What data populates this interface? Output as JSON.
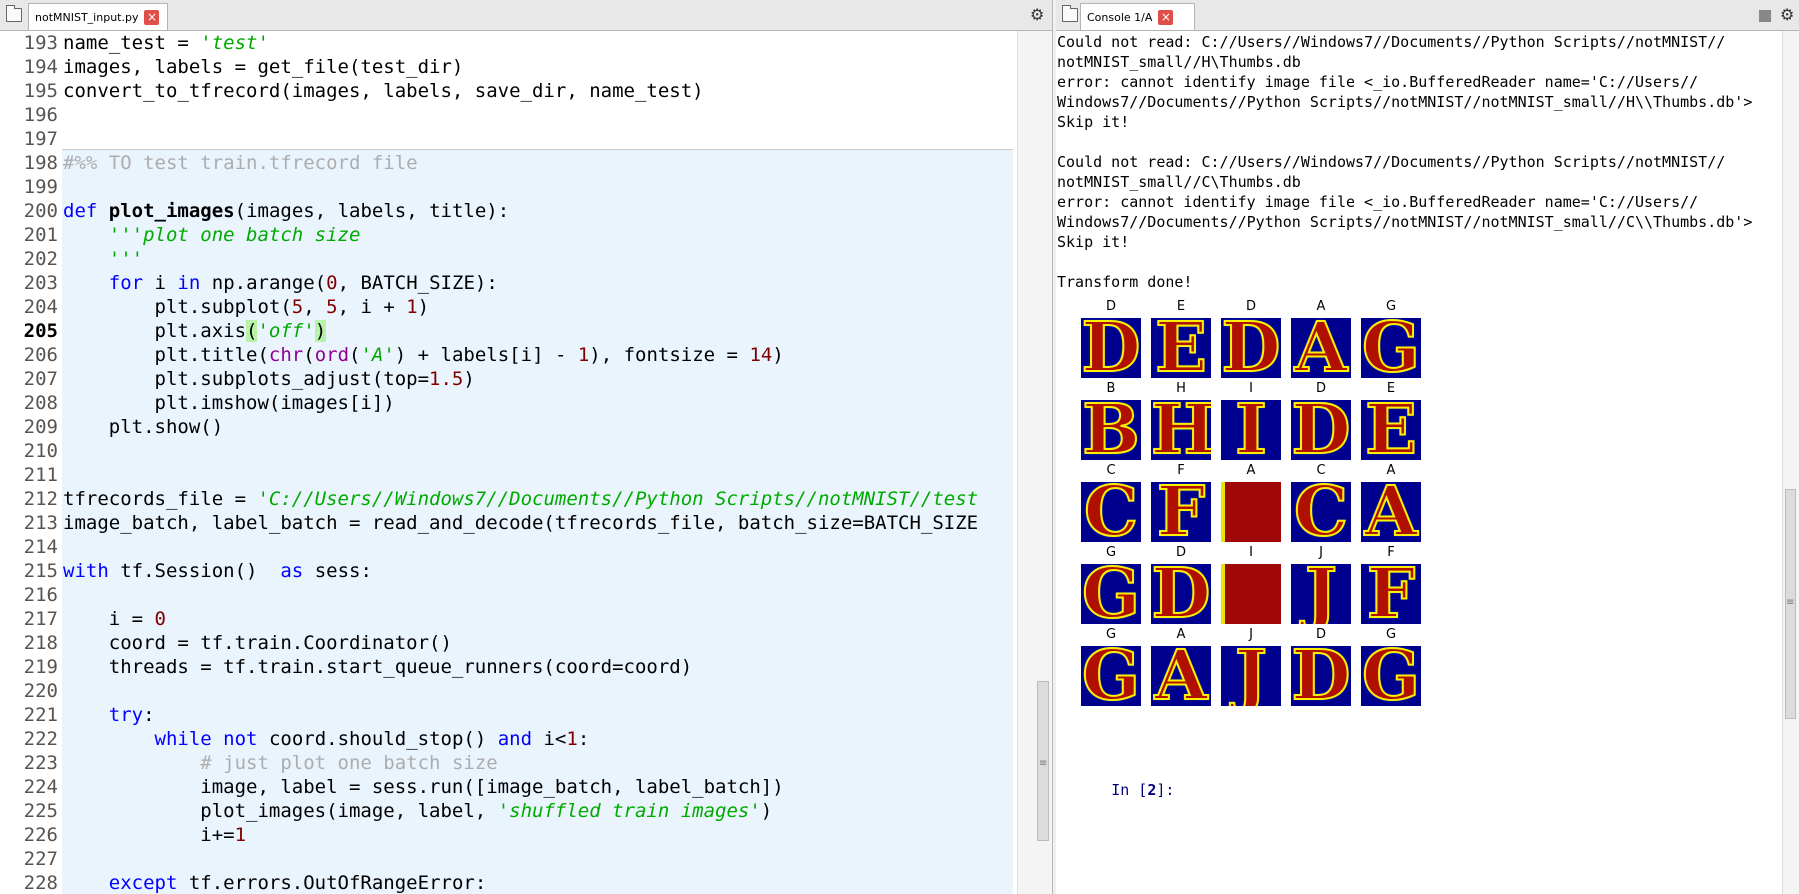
{
  "editor": {
    "tab_label": "notMNIST_input.py",
    "close_glyph": "×",
    "current_line": "205",
    "lines": [
      {
        "n": "193",
        "html": "name_test = <span class=\"str\">'test'</span>"
      },
      {
        "n": "194",
        "html": "images, labels = get_file(test_dir)"
      },
      {
        "n": "195",
        "html": "convert_to_tfrecord(images, labels, save_dir, name_test)"
      },
      {
        "n": "196",
        "html": ""
      },
      {
        "n": "197",
        "html": ""
      },
      {
        "n": "198",
        "html": "<span class=\"cmt\">#%% TO test train.tfrecord file</span>"
      },
      {
        "n": "199",
        "html": ""
      },
      {
        "n": "200",
        "html": "<span class=\"kw\">def</span> <b>plot_images</b>(images, labels, title):"
      },
      {
        "n": "201",
        "html": "    <span class=\"str\">'''plot one batch size</span>"
      },
      {
        "n": "202",
        "html": "    <span class=\"str\">'''</span>"
      },
      {
        "n": "203",
        "html": "    <span class=\"kw\">for</span> i <span class=\"kw\">in</span> np.arange(<span class=\"num\">0</span>, BATCH_SIZE):"
      },
      {
        "n": "204",
        "html": "        plt.subplot(<span class=\"num\">5</span>, <span class=\"num\">5</span>, i + <span class=\"num\">1</span>)"
      },
      {
        "n": "205",
        "html": "        plt.axis<span class=\"hl\">(</span><span class=\"str\">'off'</span><span class=\"hl\">)</span>"
      },
      {
        "n": "206",
        "html": "        plt.title(<span class=\"bi\">chr</span>(<span class=\"bi\">ord</span>(<span class=\"str\">'A'</span>) + labels[i] - <span class=\"num\">1</span>), fontsize = <span class=\"num\">14</span>)"
      },
      {
        "n": "207",
        "html": "        plt.subplots_adjust(top=<span class=\"num\">1.5</span>)"
      },
      {
        "n": "208",
        "html": "        plt.imshow(images[i])"
      },
      {
        "n": "209",
        "html": "    plt.show()"
      },
      {
        "n": "210",
        "html": ""
      },
      {
        "n": "211",
        "html": ""
      },
      {
        "n": "212",
        "html": "tfrecords_file = <span class=\"str\">'C://Users//Windows7//Documents//Python Scripts//notMNIST//test</span>"
      },
      {
        "n": "213",
        "html": "image_batch, label_batch = read_and_decode(tfrecords_file, batch_size=BATCH_SIZE"
      },
      {
        "n": "214",
        "html": ""
      },
      {
        "n": "215",
        "html": "<span class=\"kw\">with</span> tf.Session()  <span class=\"kw\">as</span> sess:"
      },
      {
        "n": "216",
        "html": ""
      },
      {
        "n": "217",
        "html": "    i = <span class=\"num\">0</span>"
      },
      {
        "n": "218",
        "html": "    coord = tf.train.Coordinator()"
      },
      {
        "n": "219",
        "html": "    threads = tf.train.start_queue_runners(coord=coord)"
      },
      {
        "n": "220",
        "html": ""
      },
      {
        "n": "221",
        "html": "    <span class=\"kw\">try</span>:"
      },
      {
        "n": "222",
        "html": "        <span class=\"kw\">while</span> <span class=\"kw\">not</span> coord.should_stop() <span class=\"kw\">and</span> i&lt;<span class=\"num\">1</span>:"
      },
      {
        "n": "223",
        "html": "            <span class=\"cmt\"># just plot one batch size</span>"
      },
      {
        "n": "224",
        "html": "            image, label = sess.run([image_batch, label_batch])"
      },
      {
        "n": "225",
        "html": "            plot_images(image, label, <span class=\"str\">'shuffled train images'</span>)"
      },
      {
        "n": "226",
        "html": "            i+=<span class=\"num\">1</span>"
      },
      {
        "n": "227",
        "html": ""
      },
      {
        "n": "228",
        "html": "    <span class=\"kw\">except</span> tf.errors.OutOfRangeError:"
      }
    ]
  },
  "console": {
    "tab_label": "Console 1/A",
    "close_glyph": "×",
    "lines": [
      "Could not read: C://Users//Windows7//Documents//Python Scripts//notMNIST//",
      "notMNIST_small//H\\Thumbs.db",
      "error: cannot identify image file <_io.BufferedReader name='C://Users//",
      "Windows7//Documents//Python Scripts//notMNIST//notMNIST_small//H\\\\Thumbs.db'>",
      "Skip it!",
      "",
      "Could not read: C://Users//Windows7//Documents//Python Scripts//notMNIST//",
      "notMNIST_small//C\\Thumbs.db",
      "error: cannot identify image file <_io.BufferedReader name='C://Users//",
      "Windows7//Documents//Python Scripts//notMNIST//notMNIST_small//C\\\\Thumbs.db'>",
      "Skip it!",
      "",
      "Transform done!"
    ],
    "prompt_label": "In [",
    "prompt_number": "2",
    "prompt_end": "]:",
    "plot_titles": [
      [
        "D",
        "E",
        "D",
        "A",
        "G"
      ],
      [
        "B",
        "H",
        "I",
        "D",
        "E"
      ],
      [
        "C",
        "F",
        "A",
        "C",
        "A"
      ],
      [
        "G",
        "D",
        "I",
        "J",
        "F"
      ],
      [
        "G",
        "A",
        "J",
        "D",
        "G"
      ]
    ],
    "full_tiles": [
      "2-2",
      "3-2"
    ]
  },
  "icons": {
    "gear": "⚙",
    "stop": "■",
    "grip": "≡"
  }
}
